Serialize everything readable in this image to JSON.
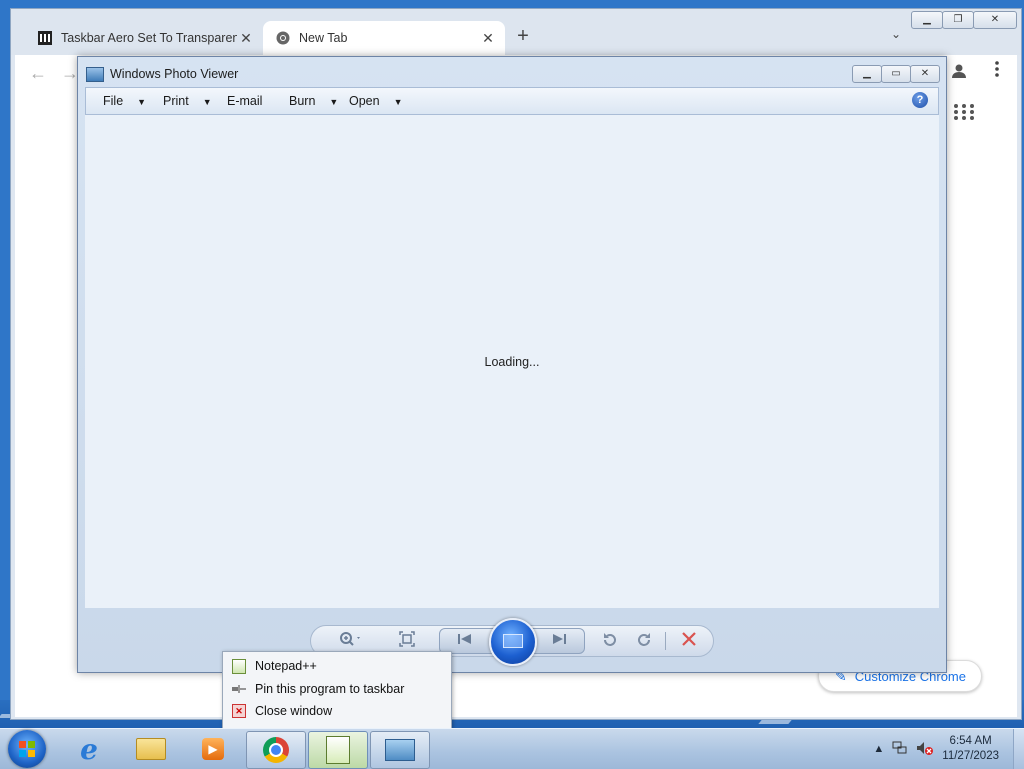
{
  "chrome": {
    "tabs": [
      {
        "title": "Taskbar Aero Set To Transparent",
        "favicon": "bank-icon",
        "active": false
      },
      {
        "title": "New Tab",
        "favicon": "chrome-icon",
        "active": true
      }
    ],
    "new_tab_symbol": "+",
    "tab_menu_symbol": "⌄",
    "customize_label": "Customize Chrome"
  },
  "photo_viewer": {
    "title": "Windows Photo Viewer",
    "menu": {
      "file": "File",
      "print": "Print",
      "email": "E-mail",
      "burn": "Burn",
      "open": "Open"
    },
    "help_symbol": "?",
    "status_text": "Loading...",
    "controls": [
      "zoom-icon",
      "actual-size-icon",
      "previous-icon",
      "slideshow-icon",
      "next-icon",
      "rotate-counterclockwise-icon",
      "rotate-clockwise-icon",
      "delete-icon"
    ]
  },
  "jump_list": {
    "items": [
      {
        "label": "Notepad++",
        "icon": "notepadpp-icon"
      },
      {
        "label": "Pin this program to taskbar",
        "icon": "pin-icon"
      },
      {
        "label": "Close window",
        "icon": "close-window-icon"
      }
    ]
  },
  "taskbar": {
    "buttons": [
      "start-button",
      "internet-explorer",
      "windows-explorer",
      "windows-media-player",
      "google-chrome",
      "notepadpp",
      "windows-photo-viewer"
    ],
    "clock_time": "6:54 AM",
    "clock_date": "11/27/2023",
    "tray_arrow": "▲"
  },
  "colors": {
    "taskbar": "#aac3e0",
    "desktop": "#2f76c8",
    "accent_link": "#1a73e8"
  }
}
